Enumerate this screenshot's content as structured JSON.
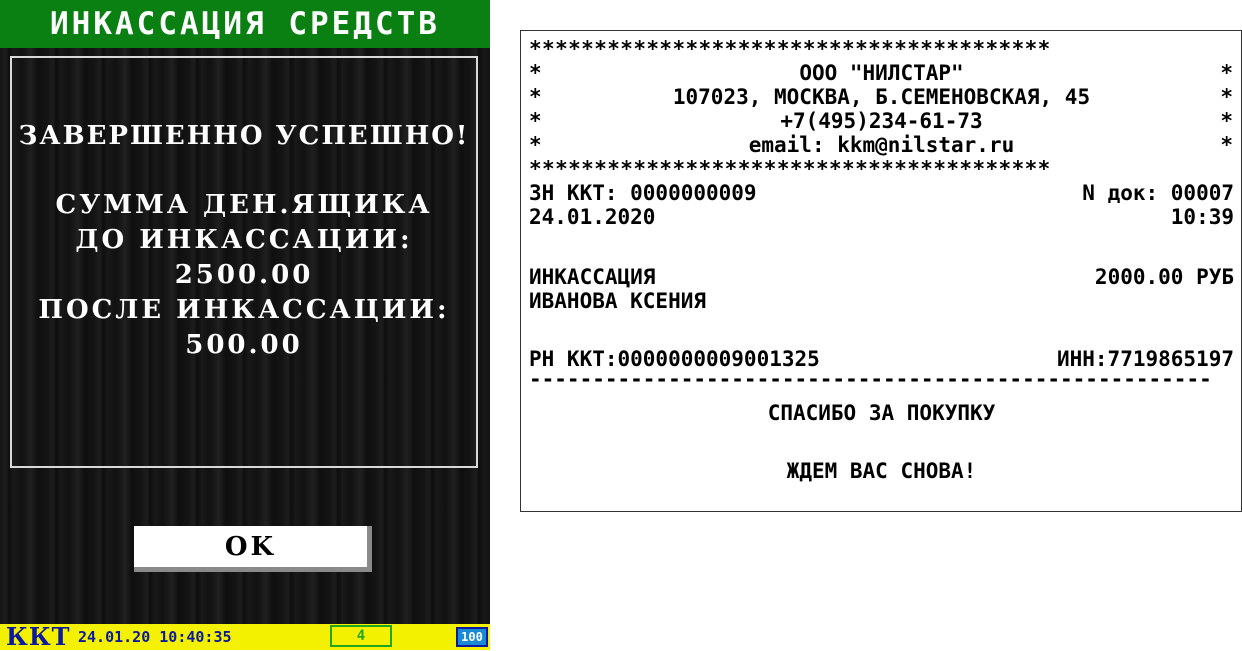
{
  "device": {
    "title": "ИНКАССАЦИЯ СРЕДСТВ",
    "status": "ЗАВЕРШЕННО УСПЕШНО!",
    "lines": [
      "СУММА ДЕН.ЯЩИКА",
      "ДО ИНКАССАЦИИ:",
      "2500.00",
      "ПОСЛЕ ИНКАССАЦИИ:",
      "500.00"
    ],
    "ok_label": "OK",
    "status_bar": {
      "label": "ККТ",
      "datetime": "24.01.20 10:40:35",
      "counter": "4",
      "battery": "100"
    },
    "colors": {
      "title_bg": "#0a7f12",
      "status_bar_bg": "#f3f000",
      "status_text": "#0a1aa0",
      "counter_border": "#1fa81f",
      "battery_fill": "#1b8ad6"
    }
  },
  "receipt": {
    "star_border": "****************************************",
    "star_edge": "*",
    "header": [
      "ООО \"НИЛСТАР\"",
      "107023, МОСКВА, Б.СЕМЕНОВСКАЯ, 45",
      "+7(495)234-61-73",
      "email: kkm@nilstar.ru"
    ],
    "zn_kkt": "ЗН ККТ: 0000000009",
    "doc_no": "N док: 00007",
    "date": "24.01.2020",
    "time": "10:39",
    "operation": "ИНКАССАЦИЯ",
    "amount": "2000.00 РУБ",
    "cashier": "ИВАНОВА КСЕНИЯ",
    "rn_kkt": "РН ККТ:0000000009001325",
    "inn": "ИНН:7719865197",
    "dashes": "------------------------------------------------------",
    "footer": [
      "СПАСИБО ЗА ПОКУПКУ",
      "ЖДЕМ ВАС СНОВА!"
    ]
  }
}
